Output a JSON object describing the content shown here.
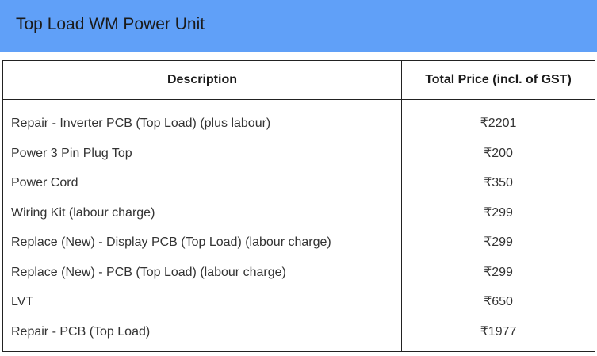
{
  "header": {
    "title": "Top Load WM Power Unit"
  },
  "table": {
    "columns": [
      "Description",
      "Total Price (incl. of GST)"
    ],
    "rows": [
      {
        "description": "Repair - Inverter PCB (Top Load) (plus labour)",
        "price": "₹2201"
      },
      {
        "description": "Power 3 Pin Plug Top",
        "price": "₹200"
      },
      {
        "description": "Power Cord",
        "price": "₹350"
      },
      {
        "description": "Wiring Kit (labour charge)",
        "price": "₹299"
      },
      {
        "description": "Replace (New) - Display PCB (Top Load) (labour charge)",
        "price": "₹299"
      },
      {
        "description": "Replace (New) - PCB (Top Load) (labour charge)",
        "price": "₹299"
      },
      {
        "description": "LVT",
        "price": "₹650"
      },
      {
        "description": "Repair - PCB (Top Load)",
        "price": "₹1977"
      }
    ]
  }
}
